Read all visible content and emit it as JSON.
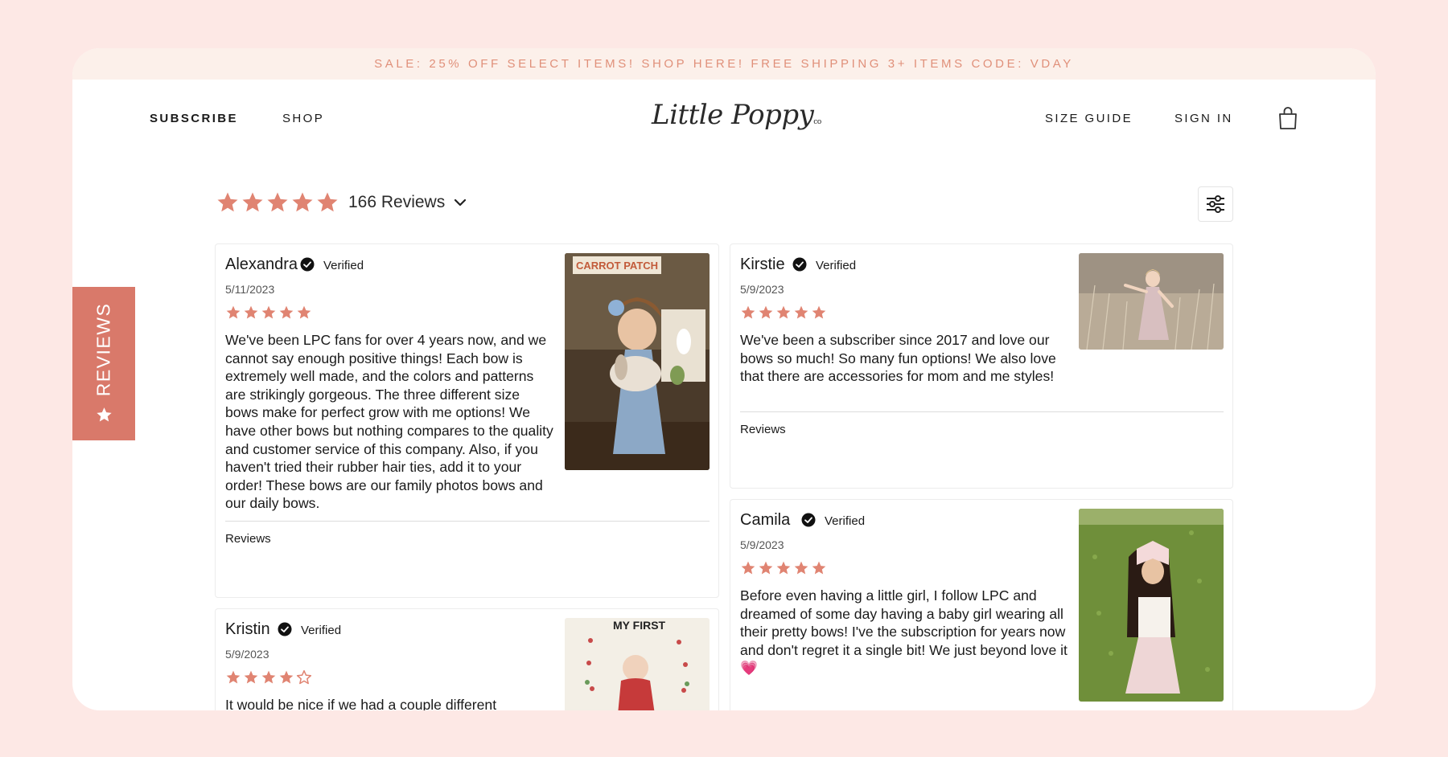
{
  "promo": {
    "text": "SALE: 25% OFF SELECT ITEMS! SHOP HERE! FREE SHIPPING 3+ ITEMS CODE: VDAY"
  },
  "nav": {
    "subscribe": "SUBSCRIBE",
    "shop": "SHOP",
    "size_guide": "SIZE GUIDE",
    "sign_in": "SIGN IN"
  },
  "logo": {
    "text": "Little Poppy",
    "suffix": "co"
  },
  "summary": {
    "rating": 5,
    "count_label": "166 Reviews"
  },
  "side_tab": {
    "label": "REVIEWS"
  },
  "reviews": [
    {
      "name": "Alexandra",
      "verified": "Verified",
      "date": "5/11/2023",
      "rating": 5,
      "body": "We've been LPC fans for over 4 years now, and we cannot say enough positive things! Each bow is extremely well made, and the colors and patterns are strikingly gorgeous. The three different size bows make for perfect grow with me options! We have other bows but nothing compares to the quality and customer service of this company. Also, if you haven't tried their rubber hair ties, add it to your order! These bows are our family photos bows and our daily bows.",
      "tag": "Reviews",
      "photo_sign": "CARROT PATCH"
    },
    {
      "name": "Kirstie",
      "verified": "Verified",
      "date": "5/9/2023",
      "rating": 5,
      "body": "We've been a subscriber since 2017 and love our bows so much! So many fun options! We also love that there are accessories for mom and me styles!",
      "tag": "Reviews"
    },
    {
      "name": "Camila",
      "verified": "Verified",
      "date": "5/9/2023",
      "rating": 5,
      "body": "Before even having a little girl, I follow LPC and dreamed of some day having a baby girl wearing all their pretty bows! I've the subscription for years now and don't regret it a single bit! We just beyond love it💗"
    },
    {
      "name": "Kristin",
      "verified": "Verified",
      "date": "5/9/2023",
      "rating": 4,
      "body": "It would be nice if we had a couple different",
      "photo_title": "MY FIRST"
    }
  ],
  "colors": {
    "accent": "#d9796a",
    "star": "#e08472",
    "promo_text": "#e0907a",
    "background": "#fde8e5"
  }
}
